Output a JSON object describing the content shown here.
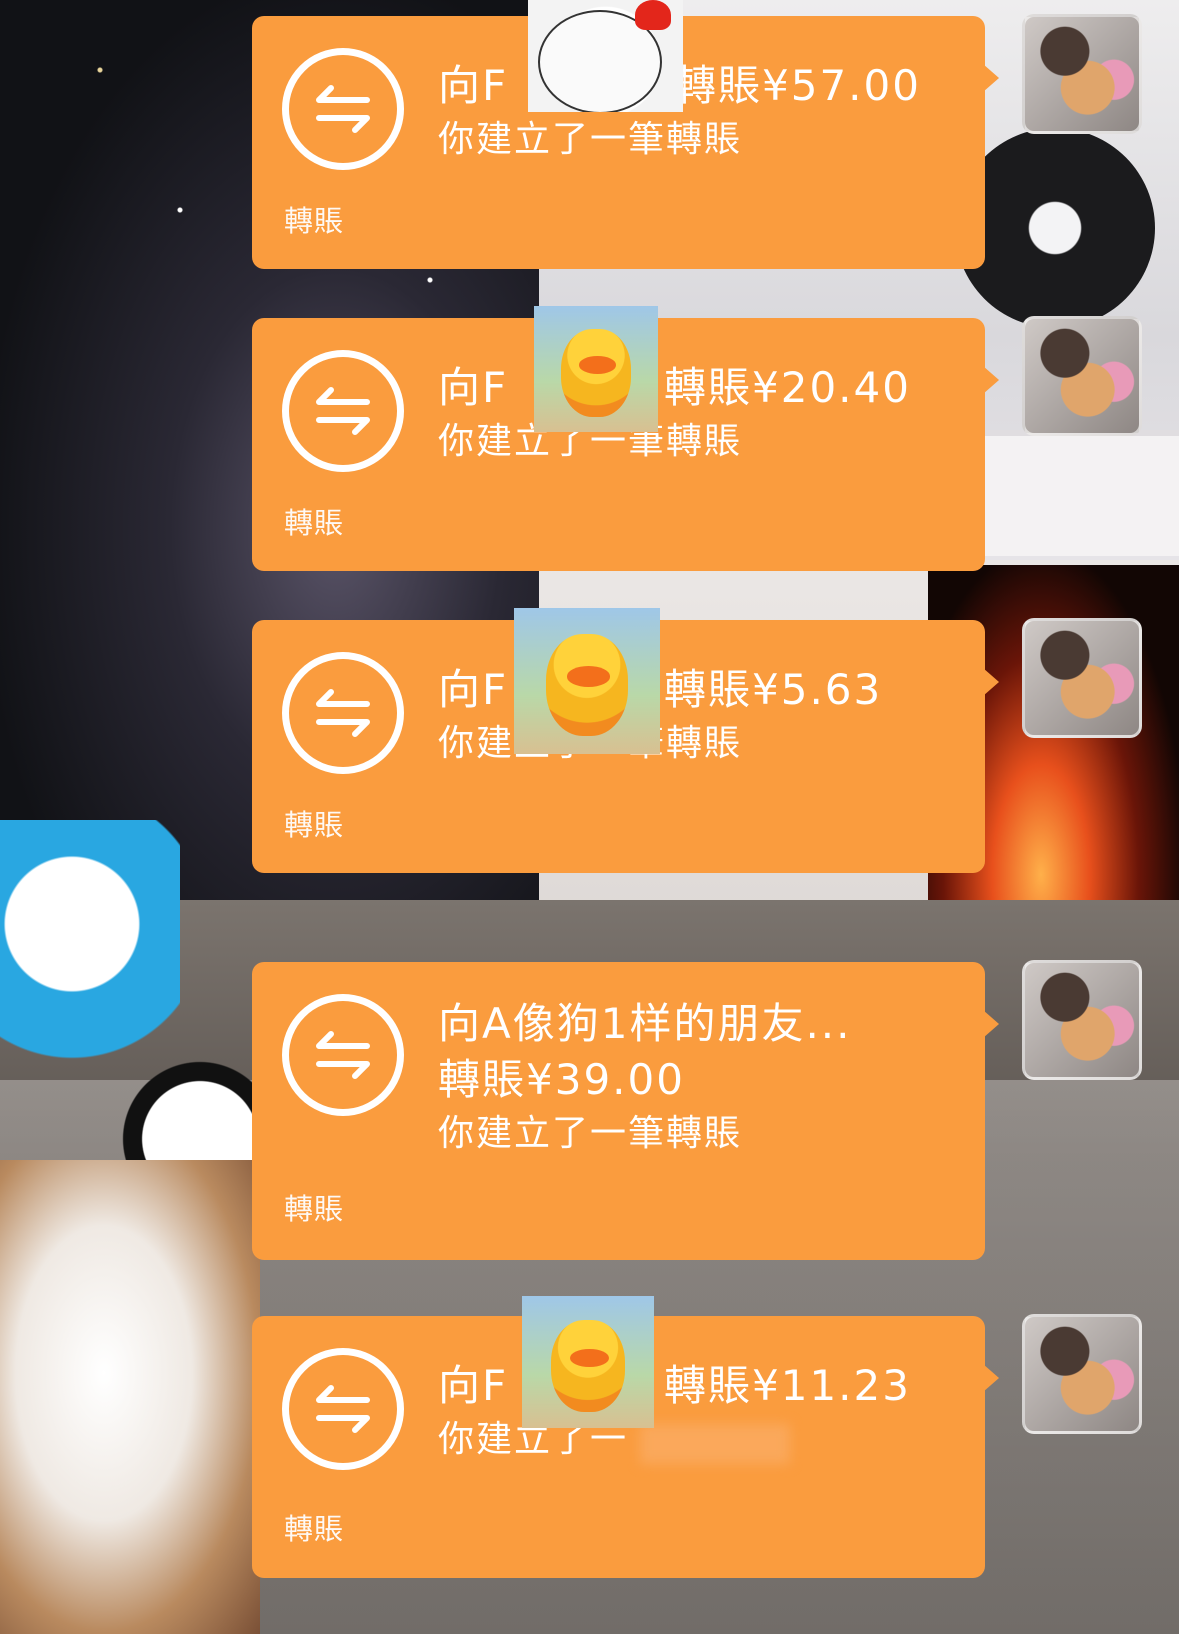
{
  "theme": {
    "bubble_color": "#fa9c3e",
    "text_color": "#ffffff"
  },
  "messages": [
    {
      "title": "向F",
      "title_tail": "轉賬¥57.00",
      "subtitle": "你建立了一筆轉賬",
      "footer": "轉賬",
      "icon": "transfer-arrows-icon",
      "sticker": "rooster-sticker"
    },
    {
      "title": "向F",
      "title_tail": "轉賬¥20.40",
      "subtitle": "你建立了一筆轉賬",
      "footer": "轉賬",
      "icon": "transfer-arrows-icon",
      "sticker": "duck-sticker"
    },
    {
      "title": "向F",
      "title_tail": "轉賬¥5.63",
      "subtitle": "你建立了一筆轉賬",
      "footer": "轉賬",
      "icon": "transfer-arrows-icon",
      "sticker": "duck-sticker"
    },
    {
      "title": "向A像狗1样的朋友...",
      "amount": "轉賬¥39.00",
      "subtitle": "你建立了一筆轉賬",
      "footer": "轉賬",
      "icon": "transfer-arrows-icon"
    },
    {
      "title": "向F",
      "title_tail": "轉賬¥11.23",
      "subtitle": "你建立了一",
      "footer": "轉賬",
      "icon": "transfer-arrows-icon",
      "sticker": "duck-sticker"
    }
  ]
}
